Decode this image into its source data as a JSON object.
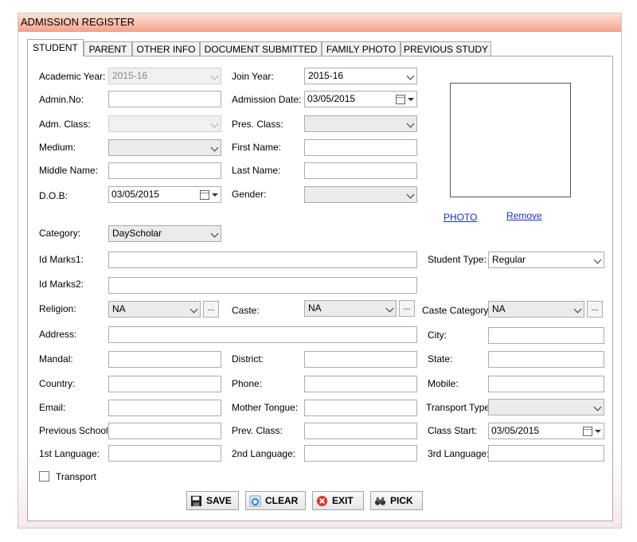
{
  "window": {
    "title": "ADMISSION REGISTER"
  },
  "tabs": [
    "STUDENT",
    "PARENT",
    "OTHER INFO",
    "DOCUMENT SUBMITTED",
    "FAMILY PHOTO",
    "PREVIOUS STUDY"
  ],
  "form": {
    "academic_year_label": "Academic Year:",
    "academic_year_value": "2015-16",
    "join_year_label": "Join Year:",
    "join_year_value": "2015-16",
    "admin_no_label": "Admin.No:",
    "admin_no_value": "",
    "admission_date_label": "Admission Date:",
    "admission_date_value": "03/05/2015",
    "adm_class_label": "Adm. Class:",
    "adm_class_value": "",
    "pres_class_label": "Pres. Class:",
    "pres_class_value": "",
    "medium_label": "Medium:",
    "medium_value": "",
    "first_name_label": "First Name:",
    "first_name_value": "",
    "middle_name_label": "Middle Name:",
    "middle_name_value": "",
    "last_name_label": "Last Name:",
    "last_name_value": "",
    "dob_label": "D.O.B:",
    "dob_value": "03/05/2015",
    "gender_label": "Gender:",
    "gender_value": "",
    "category_label": "Category:",
    "category_value": "DayScholar",
    "id_marks1_label": "Id Marks1:",
    "id_marks1_value": "",
    "student_type_label": "Student Type:",
    "student_type_value": "Regular",
    "id_marks2_label": "Id Marks2:",
    "id_marks2_value": "",
    "religion_label": "Religion:",
    "religion_value": "NA",
    "caste_label": "Caste:",
    "caste_value": "NA",
    "caste_category_label": "Caste Category:",
    "caste_category_value": "NA",
    "ellipsis": "...",
    "address_label": "Address:",
    "address_value": "",
    "city_label": "City:",
    "city_value": "",
    "mandal_label": "Mandal:",
    "mandal_value": "",
    "district_label": "District:",
    "district_value": "",
    "state_label": "State:",
    "state_value": "",
    "country_label": "Country:",
    "country_value": "",
    "phone_label": "Phone:",
    "phone_value": "",
    "mobile_label": "Mobile:",
    "mobile_value": "",
    "email_label": "Email:",
    "email_value": "",
    "mother_tongue_label": "Mother Tongue:",
    "mother_tongue_value": "",
    "transport_type_label": "Transport Type",
    "transport_type_value": "",
    "previous_school_label": "Previous School:",
    "previous_school_value": "",
    "prev_class_label": "Prev. Class:",
    "prev_class_value": "",
    "class_start_label": "Class Start:",
    "class_start_value": "03/05/2015",
    "lang1_label": "1st Language:",
    "lang1_value": "",
    "lang2_label": "2nd Language:",
    "lang2_value": "",
    "lang3_label": "3rd Language:",
    "lang3_value": "",
    "transport_label": "Transport"
  },
  "photo": {
    "photo_link": "PHOTO",
    "remove_link": "Remove"
  },
  "buttons": {
    "save": "SAVE",
    "clear": "CLEAR",
    "exit": "EXIT",
    "pick": "PICK"
  },
  "icons": {
    "save": "floppy-disk-icon",
    "clear": "eraser-icon",
    "exit": "close-circle-icon",
    "pick": "binoculars-icon"
  },
  "colors": {
    "titlebar_start": "#fde3d9",
    "titlebar_end": "#f6a38a",
    "link": "#1a2ec8",
    "exit_icon": "#d9342b"
  }
}
